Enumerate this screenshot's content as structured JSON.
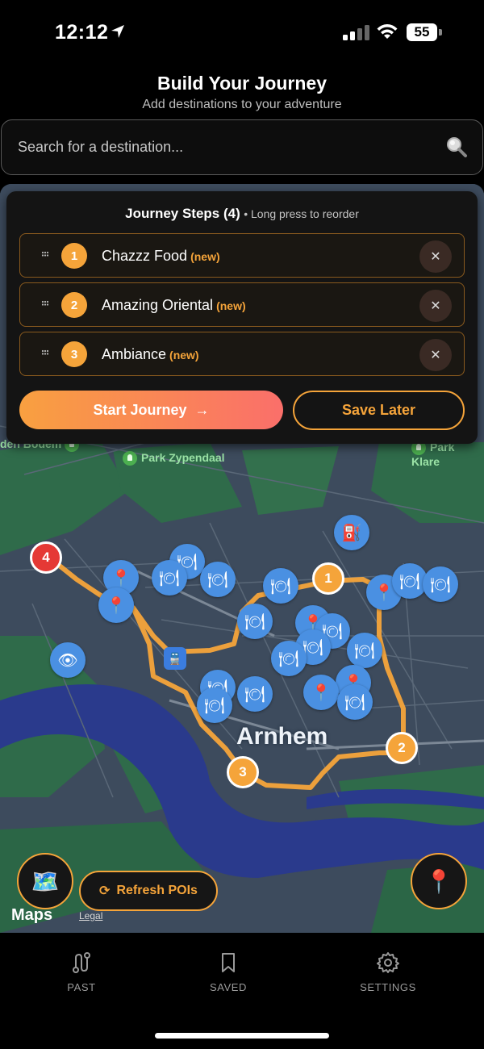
{
  "status_bar": {
    "time": "12:12",
    "battery": "55"
  },
  "header": {
    "title": "Build Your Journey",
    "subtitle": "Add destinations to your adventure"
  },
  "search": {
    "placeholder": "Search for a destination..."
  },
  "journey": {
    "title": "Journey Steps (4)",
    "hint": "• Long press to reorder",
    "steps": [
      {
        "number": "1",
        "name": "Chazzz Food",
        "tag": "(new)"
      },
      {
        "number": "2",
        "name": "Amazing Oriental",
        "tag": "(new)"
      },
      {
        "number": "3",
        "name": "Ambiance",
        "tag": "(new)"
      }
    ],
    "start_label": "Start Journey",
    "save_label": "Save Later"
  },
  "map": {
    "city": "Arnhem",
    "parks": [
      "den Bodem",
      "Park Zypendaal",
      "Park Klare"
    ],
    "markers": [
      "1",
      "2",
      "3",
      "4"
    ],
    "refresh_label": "Refresh POIs",
    "maps_brand": "Maps",
    "legal": "Legal"
  },
  "nav": {
    "items": [
      {
        "label": "PAST",
        "icon": "route-icon"
      },
      {
        "label": "SAVED",
        "icon": "bookmark-icon"
      },
      {
        "label": "SETTINGS",
        "icon": "gear-icon"
      }
    ]
  },
  "colors": {
    "accent": "#f5a43a",
    "poi": "#4a90e2",
    "end_marker": "#e53935"
  }
}
